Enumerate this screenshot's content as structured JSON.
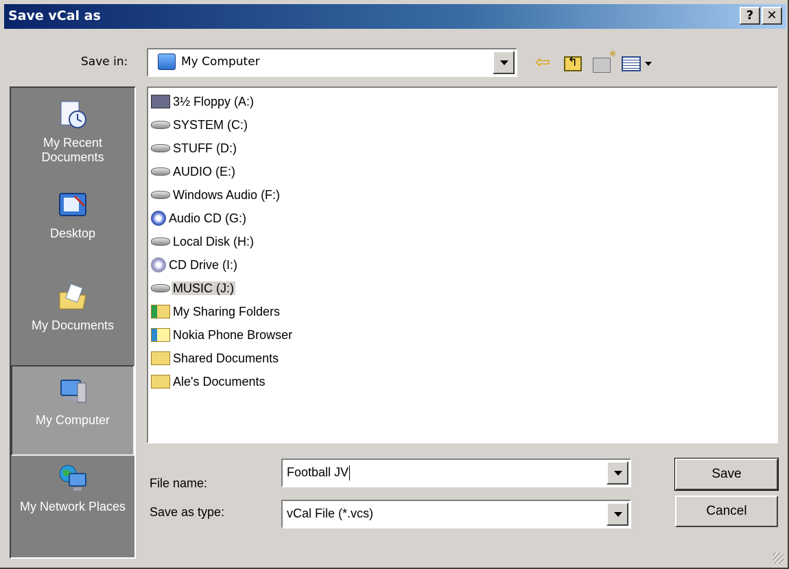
{
  "window": {
    "title": "Save vCal as",
    "help_label": "?",
    "close_label": "✕"
  },
  "toolbar": {
    "save_in_label": "Save in:",
    "save_in_value": "My Computer"
  },
  "places": [
    {
      "label": "My Recent Documents",
      "selected": false
    },
    {
      "label": "Desktop",
      "selected": false
    },
    {
      "label": "My Documents",
      "selected": false
    },
    {
      "label": "My Computer",
      "selected": true
    },
    {
      "label": "My Network Places",
      "selected": false
    }
  ],
  "files": [
    {
      "name": "3½ Floppy (A:)",
      "icon": "floppy-icon"
    },
    {
      "name": "SYSTEM (C:)",
      "icon": "hard-drive-icon"
    },
    {
      "name": "STUFF (D:)",
      "icon": "hard-drive-icon"
    },
    {
      "name": "AUDIO (E:)",
      "icon": "hard-drive-icon"
    },
    {
      "name": "Windows Audio (F:)",
      "icon": "hard-drive-icon"
    },
    {
      "name": "Audio CD (G:)",
      "icon": "audio-cd-icon"
    },
    {
      "name": "Local Disk (H:)",
      "icon": "hard-drive-icon"
    },
    {
      "name": "CD Drive (I:)",
      "icon": "cd-drive-icon"
    },
    {
      "name": "MUSIC (J:)",
      "icon": "hard-drive-icon",
      "selected": true
    },
    {
      "name": "My Sharing Folders",
      "icon": "sharing-folder-icon"
    },
    {
      "name": "Nokia Phone Browser",
      "icon": "nokia-browser-icon"
    },
    {
      "name": "Shared Documents",
      "icon": "folder-icon"
    },
    {
      "name": "Ale's Documents",
      "icon": "folder-icon"
    }
  ],
  "form": {
    "file_name_label": "File name:",
    "file_name_value": "Football JV",
    "save_as_type_label": "Save as type:",
    "save_as_type_value": "vCal File (*.vcs)"
  },
  "buttons": {
    "save": "Save",
    "cancel": "Cancel"
  }
}
